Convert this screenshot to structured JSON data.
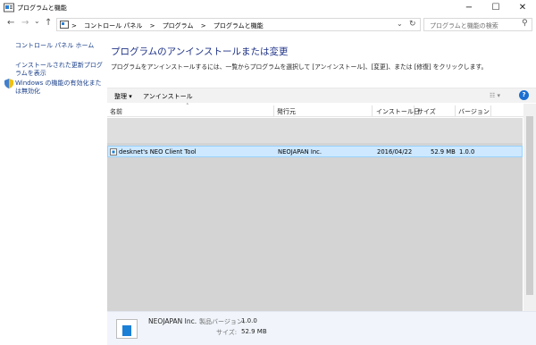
{
  "window": {
    "title": "プログラムと機能",
    "minimize": "−",
    "maximize": "☐",
    "close": "✕"
  },
  "address": {
    "back_icon": "←",
    "forward_icon": "→",
    "dropdown_icon": "⌄",
    "up_icon": "↑",
    "crumbs": [
      "コントロール パネル",
      "プログラム",
      "プログラムと機能"
    ],
    "sep": ">",
    "refresh_icon": "↻",
    "search_placeholder": "プログラムと機能の検索",
    "search_icon": "⚲"
  },
  "sidebar": {
    "links": [
      "コントロール パネル ホーム",
      "インストールされた更新プログラムを表示",
      "Windows の機能の有効化または無効化"
    ]
  },
  "main": {
    "heading": "プログラムのアンインストールまたは変更",
    "description": "プログラムをアンインストールするには、一覧からプログラムを選択して [アンインストール]、[変更]、または [修復] をクリックします。"
  },
  "toolbar": {
    "organize": "整理 ▾",
    "uninstall": "アンインストール",
    "view": "☷ ▾",
    "help": "?"
  },
  "columns": {
    "name": "名前",
    "publisher": "発行元",
    "installed_on": "インストール日",
    "size": "サイズ",
    "version": "バージョン",
    "sort_icon": "˄"
  },
  "rows": [
    {
      "name": "desknet's NEO Client Tool",
      "publisher": "NEOJAPAN Inc.",
      "installed_on": "2016/04/22",
      "size": "52.9 MB",
      "version": "1.0.0"
    }
  ],
  "details": {
    "publisher": "NEOJAPAN Inc.",
    "version_label": "製品バージョン:",
    "version": "1.0.0",
    "size_label": "サイズ:",
    "size": "52.9 MB"
  },
  "colors": {
    "accent": "#1e3287",
    "selection": "#cde8ff",
    "selection_border": "#99d1ff",
    "link": "#1a3f8a"
  }
}
